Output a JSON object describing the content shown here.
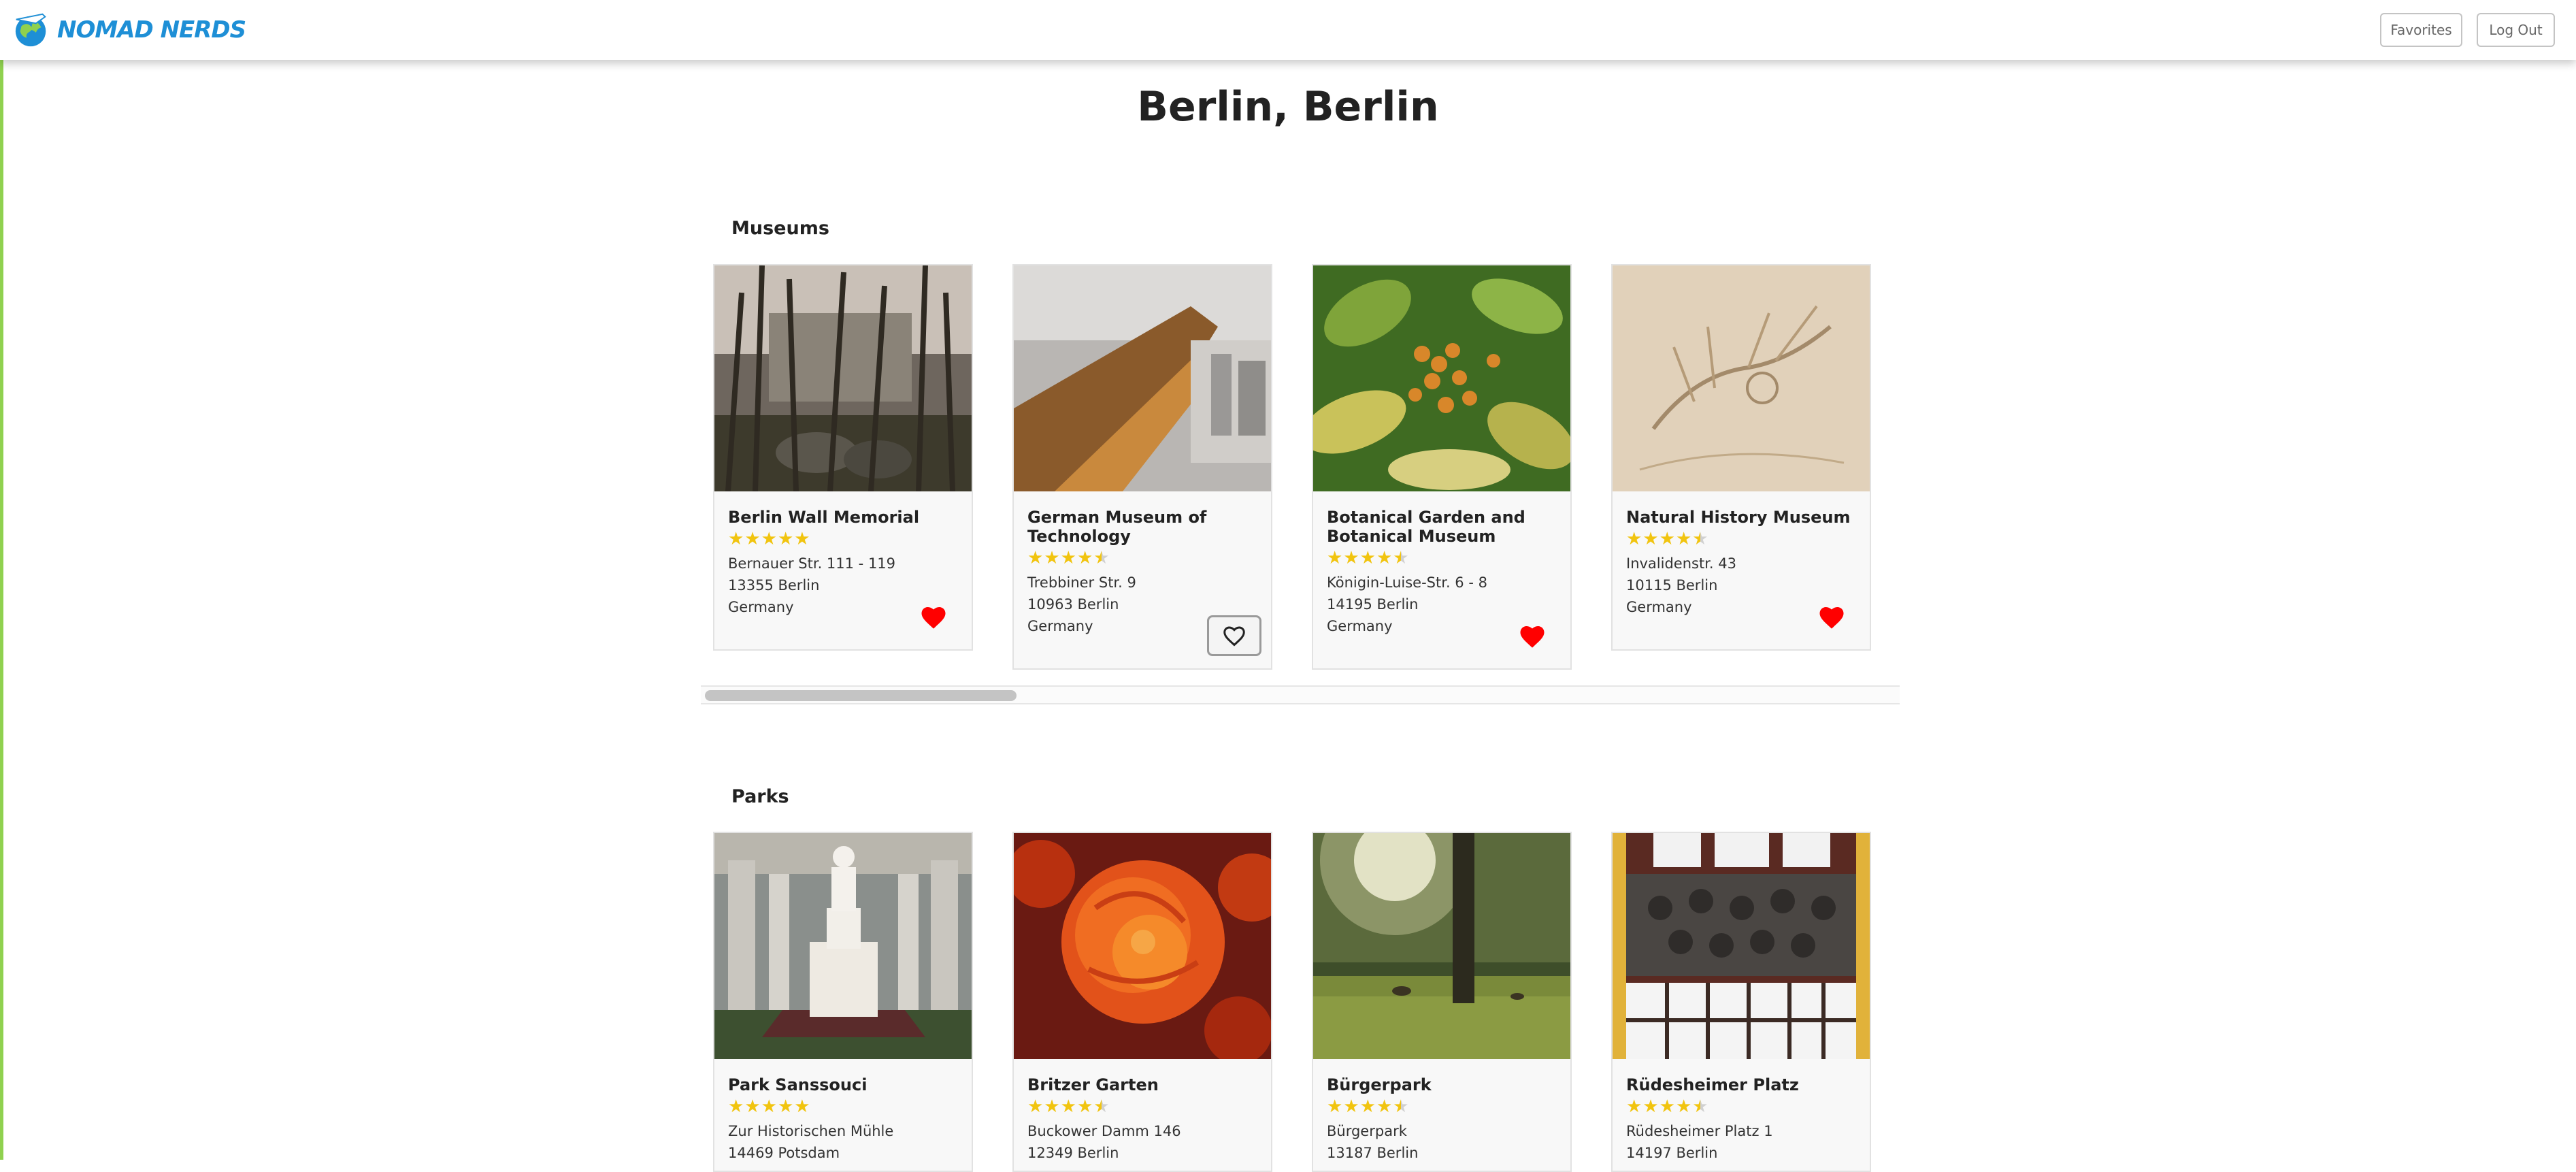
{
  "brand": {
    "name": "NOMAD NERDS"
  },
  "nav": {
    "favorites_label": "Favorites",
    "logout_label": "Log Out"
  },
  "page": {
    "title": "Berlin, Berlin"
  },
  "sections": [
    {
      "title": "Museums",
      "cards": [
        {
          "name": "Berlin Wall Memorial",
          "rating": 5,
          "address": [
            "Bernauer Str. 111 - 119",
            "13355 Berlin",
            "Germany"
          ],
          "favorited": true
        },
        {
          "name": "German Museum of Technology",
          "rating": 4.5,
          "address": [
            "Trebbiner Str. 9",
            "10963 Berlin",
            "Germany"
          ],
          "favorited": false
        },
        {
          "name": "Botanical Garden and Botanical Museum",
          "rating": 4.5,
          "address": [
            "Königin-Luise-Str. 6 - 8",
            "14195 Berlin",
            "Germany"
          ],
          "favorited": true
        },
        {
          "name": "Natural History Museum",
          "rating": 4.5,
          "address": [
            "Invalidenstr. 43",
            "10115 Berlin",
            "Germany"
          ],
          "favorited": true
        }
      ]
    },
    {
      "title": "Parks",
      "cards": [
        {
          "name": "Park Sanssouci",
          "rating": 5,
          "address": [
            "Zur Historischen Mühle",
            "14469 Potsdam"
          ]
        },
        {
          "name": "Britzer Garten",
          "rating": 4.5,
          "address": [
            "Buckower Damm 146",
            "12349 Berlin"
          ]
        },
        {
          "name": "Bürgerpark",
          "rating": 4.5,
          "address": [
            "Bürgerpark",
            "13187 Berlin"
          ]
        },
        {
          "name": "Rüdesheimer Platz",
          "rating": 4.5,
          "address": [
            "Rüdesheimer Platz 1",
            "14197 Berlin"
          ]
        }
      ]
    }
  ],
  "colors": {
    "accent": "#1e8fd6",
    "star": "#f1c40f",
    "heart": "#ff0000",
    "left_border": "#8fd14f"
  },
  "icons": {
    "favorite_filled": "heart-filled-icon",
    "favorite_empty": "heart-outline-icon",
    "rating": "star-icon",
    "logo": "globe-plane-icon"
  }
}
